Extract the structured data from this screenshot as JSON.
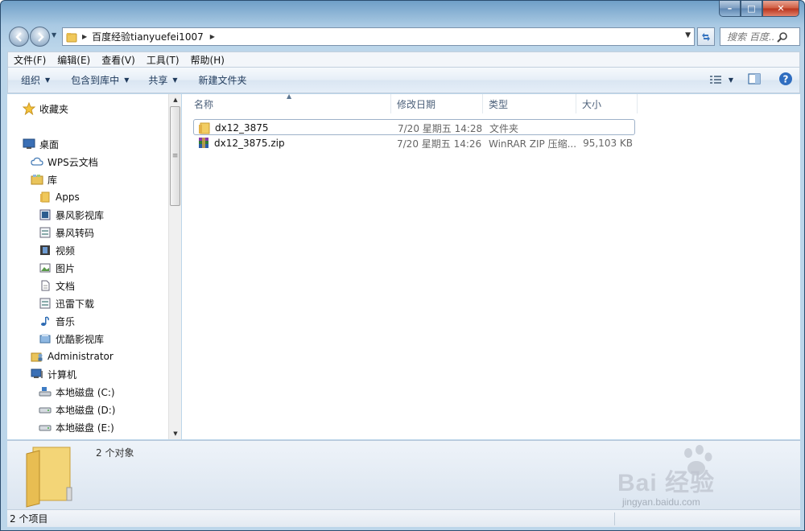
{
  "window": {
    "caption_buttons": {
      "minimize": "–",
      "maximize": "□",
      "close": "✕"
    }
  },
  "address": {
    "path": "百度经验tianyuefei1007",
    "search_placeholder": "搜索 百度..."
  },
  "menubar": {
    "items": [
      "文件(F)",
      "编辑(E)",
      "查看(V)",
      "工具(T)",
      "帮助(H)"
    ]
  },
  "commandbar": {
    "organize": "组织",
    "include_in_library": "包含到库中",
    "share": "共享",
    "new_folder": "新建文件夹"
  },
  "navpane": {
    "favorites": "收藏夹",
    "desktop": "桌面",
    "wps_cloud": "WPS云文档",
    "libraries": "库",
    "lib_items": [
      "Apps",
      "暴风影视库",
      "暴风转码",
      "视频",
      "图片",
      "文档",
      "迅雷下载",
      "音乐",
      "优酷影视库"
    ],
    "administrator": "Administrator",
    "computer": "计算机",
    "drives": [
      "本地磁盘 (C:)",
      "本地磁盘 (D:)",
      "本地磁盘 (E:)"
    ]
  },
  "columns": {
    "name": "名称",
    "modified": "修改日期",
    "type": "类型",
    "size": "大小"
  },
  "files": [
    {
      "name": "dx12_3875",
      "modified": "7/20 星期五 14:28",
      "type": "文件夹",
      "size": "",
      "icon": "folder-icon"
    },
    {
      "name": "dx12_3875.zip",
      "modified": "7/20 星期五 14:26",
      "type": "WinRAR ZIP 压缩...",
      "size": "95,103 KB",
      "icon": "winrar-archive-icon"
    }
  ],
  "details": {
    "count": "2 个对象"
  },
  "statusbar": {
    "text": "2 个项目"
  },
  "watermark": {
    "brand": "Bai 经验",
    "url": "jingyan.baidu.com"
  }
}
